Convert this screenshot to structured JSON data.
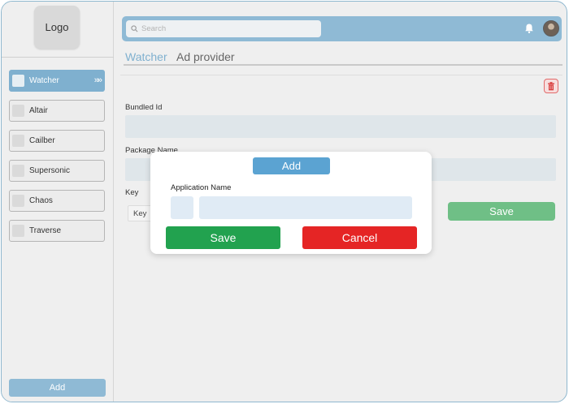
{
  "logo": {
    "text": "Logo"
  },
  "sidebar": {
    "items": [
      {
        "label": "Watcher",
        "active": true
      },
      {
        "label": "Altair",
        "active": false
      },
      {
        "label": "Cailber",
        "active": false
      },
      {
        "label": "Supersonic",
        "active": false
      },
      {
        "label": "Chaos",
        "active": false
      },
      {
        "label": "Traverse",
        "active": false
      }
    ],
    "add_label": "Add"
  },
  "header": {
    "search": {
      "placeholder": "Search",
      "value": ""
    },
    "icons": [
      "search-icon",
      "bell-icon",
      "avatar"
    ]
  },
  "tabs": [
    {
      "label": "Watcher",
      "active": true
    },
    {
      "label": "Ad provider",
      "active": false
    }
  ],
  "form": {
    "bundled_id_label": "Bundled Id",
    "package_name_label": "Package Name",
    "key_label": "Key",
    "key_value": "Key",
    "save_label": "Save"
  },
  "modal": {
    "title": "Add",
    "field_label": "Application Name",
    "field_value": "",
    "save_label": "Save",
    "cancel_label": "Cancel"
  },
  "colors": {
    "accent": "#8fbad5",
    "active_tab": "#7fb0cf",
    "save_green": "#22a24f",
    "cancel_red": "#e52525",
    "background": "#efefef"
  }
}
